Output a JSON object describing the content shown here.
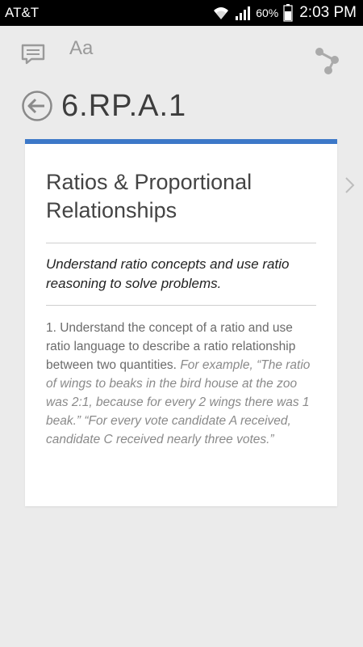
{
  "status_bar": {
    "carrier": "AT&T",
    "battery_percent": "60%",
    "time": "2:03 PM",
    "icons": [
      "wifi-icon",
      "signal-icon",
      "battery-icon"
    ]
  },
  "toolbar": {
    "font_label": "Aa",
    "icons": [
      "comment-icon",
      "font-size-icon",
      "share-icon"
    ]
  },
  "header": {
    "title": "6.RP.A.1",
    "back_icon": "back-arrow-icon"
  },
  "card": {
    "accent_color": "#3c78c8",
    "domain_title": "Ratios & Proportional Relationships",
    "cluster": "Understand ratio concepts and use ratio reasoning to solve problems.",
    "standard_text": "1. Understand the concept of a ratio and use ratio language to describe a ratio relationship between two quantities.",
    "standard_example": "For example, “The ratio of wings to beaks in the bird house at the zoo was 2:1, because for every 2 wings there was 1 beak.” “For every vote candidate A received, candidate C received nearly three votes.”"
  },
  "navigation": {
    "next_icon": "chevron-right-icon"
  }
}
